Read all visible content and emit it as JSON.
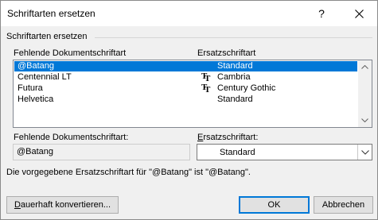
{
  "window": {
    "title": "Schriftarten ersetzen",
    "help_label": "?",
    "close_icon": "close-icon"
  },
  "group": {
    "label": "Schriftarten ersetzen"
  },
  "table": {
    "headers": {
      "missing": "Fehlende Dokumentschriftart",
      "substitute": "Ersatzschriftart"
    },
    "rows": [
      {
        "missing": "@Batang",
        "substitute": "Standard",
        "truetype_icon": false,
        "selected": true
      },
      {
        "missing": "Centennial LT",
        "substitute": "Cambria",
        "truetype_icon": true,
        "selected": false
      },
      {
        "missing": "Futura",
        "substitute": "Century Gothic",
        "truetype_icon": true,
        "selected": false
      },
      {
        "missing": "Helvetica",
        "substitute": "Standard",
        "truetype_icon": false,
        "selected": false
      }
    ],
    "truetype_glyph": "T"
  },
  "fields": {
    "missing_label_pre": "Fehlende Dokumentschriftart:",
    "missing_value": "@Batang",
    "substitute_label_accel": "E",
    "substitute_label_rest": "rsatzschriftart:",
    "substitute_value": "Standard"
  },
  "info": {
    "text": "Die vorgegebene Ersatzschriftart für \"@Batang\" ist \"@Batang\"."
  },
  "buttons": {
    "convert_accel": "D",
    "convert_rest": "auerhaft konvertieren...",
    "ok": "OK",
    "cancel": "Abbrechen"
  },
  "colors": {
    "selection": "#0078d7",
    "default_button_border": "#0078d7"
  }
}
